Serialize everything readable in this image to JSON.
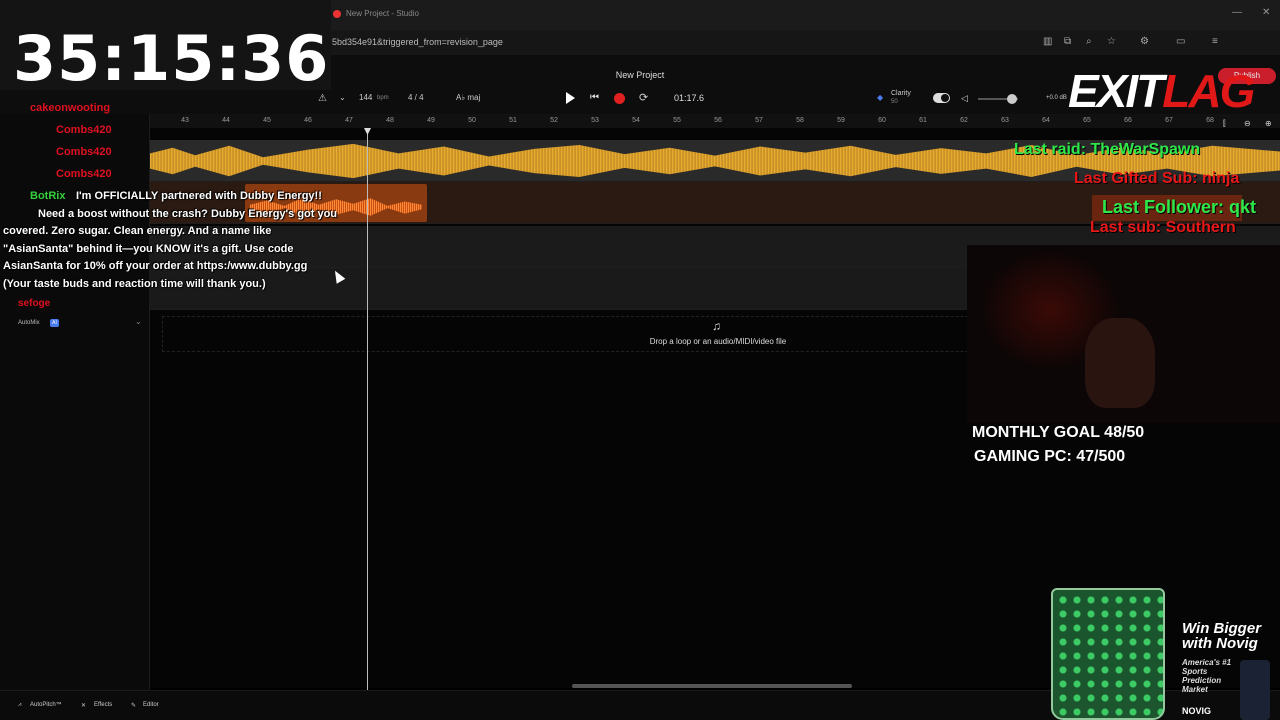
{
  "browser": {
    "tab_title": "New Project - Studio",
    "url": "5bd354e91&triggered_from=revision_page"
  },
  "studio": {
    "project_title": "New Project",
    "bpm_value": "144",
    "bpm_unit": "bpm",
    "time_signature": "4 / 4",
    "key": "A♭ maj",
    "time": "01:17.6",
    "clarity_label": "Clarity",
    "clarity_value": "50",
    "master_db": "+0.0 dB",
    "publish_label": "Publish",
    "automix_label": "AutoMix",
    "automix_badge": "AI",
    "drop_text": "Drop a loop or an audio/MIDI/video file",
    "ruler": [
      "43",
      "44",
      "45",
      "46",
      "47",
      "48",
      "49",
      "50",
      "51",
      "52",
      "53",
      "54",
      "55",
      "56",
      "57",
      "58",
      "59",
      "60",
      "61",
      "62",
      "63",
      "64",
      "65",
      "66",
      "67",
      "68"
    ],
    "bottom": {
      "autopitch": "AutoPitch™",
      "effects": "Effects",
      "editor": "Editor"
    }
  },
  "overlay": {
    "timer": "35:15:36",
    "chat": [
      {
        "name": "cakeonwooting",
        "color": "#e01020",
        "text": ""
      },
      {
        "name": "Combs420",
        "color": "#e01020",
        "text": ""
      },
      {
        "name": "Combs420",
        "color": "#e01020",
        "text": ""
      },
      {
        "name": "Combs420",
        "color": "#e01020",
        "text": ""
      },
      {
        "name": "BotRix",
        "color": "#34d03c",
        "text": "I'm OFFICIALLY partnered with Dubby Energy!!"
      },
      {
        "name": "",
        "color": "",
        "text": "Need a boost without the crash? Dubby Energy's got you"
      },
      {
        "name": "",
        "color": "",
        "text": "covered. Zero sugar. Clean energy. And a name like"
      },
      {
        "name": "",
        "color": "",
        "text": "\"AsianSanta\" behind it—you KNOW it's a gift.  Use code"
      },
      {
        "name": "",
        "color": "",
        "text": "AsianSanta for 10% off your order at https:/www.dubby.gg"
      },
      {
        "name": "",
        "color": "",
        "text": "(Your taste buds and reaction time will thank you.)"
      },
      {
        "name": "sefoge",
        "color": "#e01020",
        "text": ""
      }
    ],
    "logo_exit": "EXIT",
    "logo_lag": "LAG",
    "last_raid": "Last raid: TheWarSpawn",
    "last_gifted": "Last Gifted Sub: ninja",
    "last_follower": "Last Follower: qkt",
    "last_sub": "Last sub: Southern",
    "goal_monthly": "MONTHLY GOAL 48/50",
    "goal_pc": "GAMING PC: 47/500",
    "ad_title_1": "Win Bigger",
    "ad_title_2": "with Novig",
    "ad_sub": "America's #1 Sports Prediction Market",
    "ad_brand": "NOVIG"
  },
  "colors": {
    "waveform": "#f0b030",
    "vocal_clip": "#ff8a3a",
    "alert_green": "#2ee84a",
    "alert_red": "#e81818",
    "record": "#e02020"
  }
}
